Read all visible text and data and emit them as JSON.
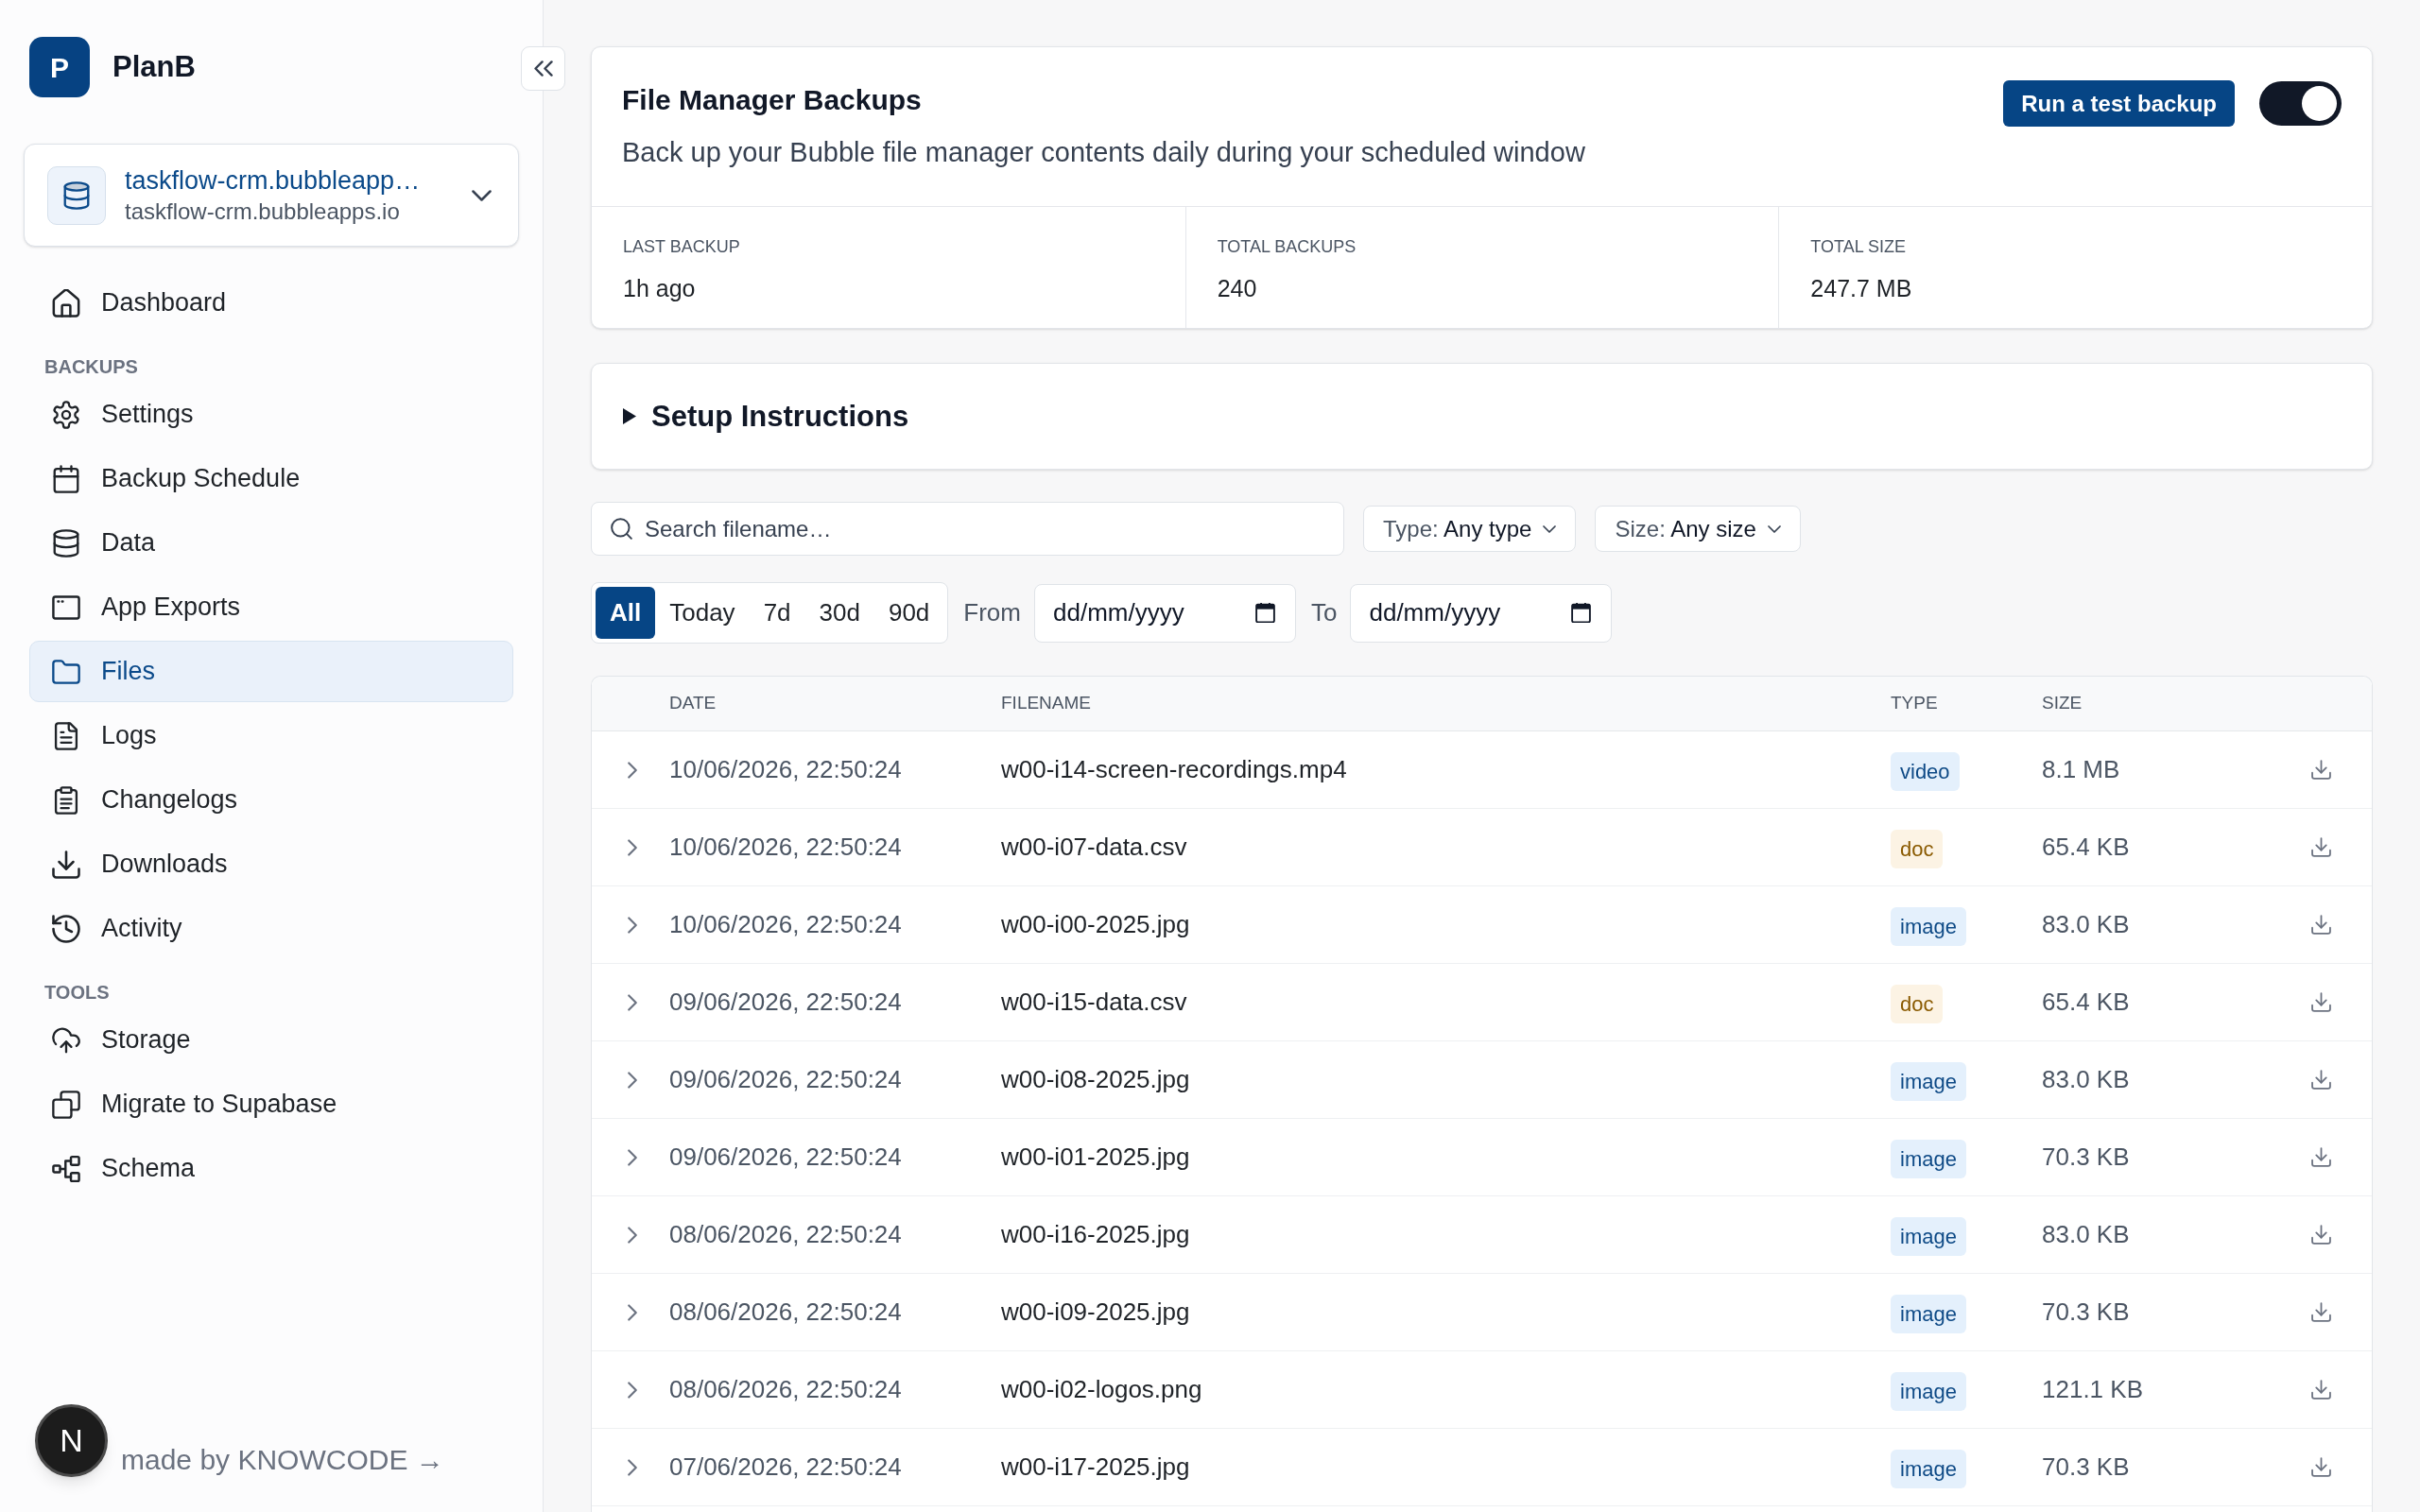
{
  "sidebar": {
    "logo_letter": "P",
    "brand": "PlanB",
    "app_selector": {
      "title": "taskflow-crm.bubbleapp…",
      "subtitle": "taskflow-crm.bubbleapps.io"
    },
    "sections": [
      {
        "items": [
          {
            "label": "Dashboard",
            "selected": false
          }
        ]
      },
      {
        "title": "BACKUPS",
        "items": [
          {
            "label": "Settings",
            "selected": false
          },
          {
            "label": "Backup Schedule",
            "selected": false
          },
          {
            "label": "Data",
            "selected": false
          },
          {
            "label": "App Exports",
            "selected": false
          },
          {
            "label": "Files",
            "selected": true
          },
          {
            "label": "Logs",
            "selected": false
          },
          {
            "label": "Changelogs",
            "selected": false
          },
          {
            "label": "Downloads",
            "selected": false
          },
          {
            "label": "Activity",
            "selected": false
          }
        ]
      },
      {
        "title": "TOOLS",
        "items": [
          {
            "label": "Storage",
            "selected": false
          },
          {
            "label": "Migrate to Supabase",
            "selected": false
          },
          {
            "label": "Schema",
            "selected": false
          }
        ]
      }
    ],
    "footer": "made by KNOWCODE →"
  },
  "dev_tools_button": {
    "letter": "N"
  },
  "backup_card": {
    "title": "File Manager Backups",
    "subtitle": "Back up your Bubble file manager contents daily during your scheduled window",
    "action": "Run a test backup",
    "enabled": true,
    "stats": [
      {
        "label": "LAST BACKUP",
        "value": "1h ago"
      },
      {
        "label": "TOTAL BACKUPS",
        "value": "240"
      },
      {
        "label": "TOTAL SIZE",
        "value": "247.7 MB"
      }
    ]
  },
  "setup_instructions": {
    "title": "Setup Instructions",
    "expanded": false
  },
  "filters": {
    "search": {
      "placeholder": "Search filename…"
    },
    "dropdowns": [
      {
        "label": "Type:",
        "value": "Any type"
      },
      {
        "label": "Size:",
        "value": "Any size"
      }
    ],
    "ranges": [
      {
        "label": "All",
        "selected": true
      },
      {
        "label": "Today",
        "selected": false
      },
      {
        "label": "7d",
        "selected": false
      },
      {
        "label": "30d",
        "selected": false
      },
      {
        "label": "90d",
        "selected": false
      }
    ],
    "dates": [
      {
        "label": "From",
        "placeholder": "dd/mm/yyyy"
      },
      {
        "label": "To",
        "placeholder": "dd/mm/yyyy"
      }
    ]
  },
  "table": {
    "columns": [
      "DATE",
      "FILENAME",
      "TYPE",
      "SIZE"
    ],
    "rows": [
      {
        "expanded": false,
        "date": "10/06/2026, 22:50:24",
        "filename": "w00-i14-screen-recordings.mp4",
        "type": {
          "label": "video",
          "color": "#0e4a86"
        },
        "size": "8.1 MB"
      },
      {
        "expanded": false,
        "date": "10/06/2026, 22:50:24",
        "filename": "w00-i07-data.csv",
        "type": {
          "label": "doc",
          "color": "#8a5a00"
        },
        "size": "65.4 KB"
      },
      {
        "expanded": false,
        "date": "10/06/2026, 22:50:24",
        "filename": "w00-i00-2025.jpg",
        "type": {
          "label": "image",
          "color": "#0e4a86"
        },
        "size": "83.0 KB"
      },
      {
        "expanded": false,
        "date": "09/06/2026, 22:50:24",
        "filename": "w00-i15-data.csv",
        "type": {
          "label": "doc",
          "color": "#8a5a00"
        },
        "size": "65.4 KB"
      },
      {
        "expanded": false,
        "date": "09/06/2026, 22:50:24",
        "filename": "w00-i08-2025.jpg",
        "type": {
          "label": "image",
          "color": "#0e4a86"
        },
        "size": "83.0 KB"
      },
      {
        "expanded": false,
        "date": "09/06/2026, 22:50:24",
        "filename": "w00-i01-2025.jpg",
        "type": {
          "label": "image",
          "color": "#0e4a86"
        },
        "size": "70.3 KB"
      },
      {
        "expanded": false,
        "date": "08/06/2026, 22:50:24",
        "filename": "w00-i16-2025.jpg",
        "type": {
          "label": "image",
          "color": "#0e4a86"
        },
        "size": "83.0 KB"
      },
      {
        "expanded": false,
        "date": "08/06/2026, 22:50:24",
        "filename": "w00-i09-2025.jpg",
        "type": {
          "label": "image",
          "color": "#0e4a86"
        },
        "size": "70.3 KB"
      },
      {
        "expanded": false,
        "date": "08/06/2026, 22:50:24",
        "filename": "w00-i02-logos.png",
        "type": {
          "label": "image",
          "color": "#0e4a86"
        },
        "size": "121.1 KB"
      },
      {
        "expanded": false,
        "date": "07/06/2026, 22:50:24",
        "filename": "w00-i17-2025.jpg",
        "type": {
          "label": "image",
          "color": "#0e4a86"
        },
        "size": "70.3 KB"
      }
    ]
  }
}
